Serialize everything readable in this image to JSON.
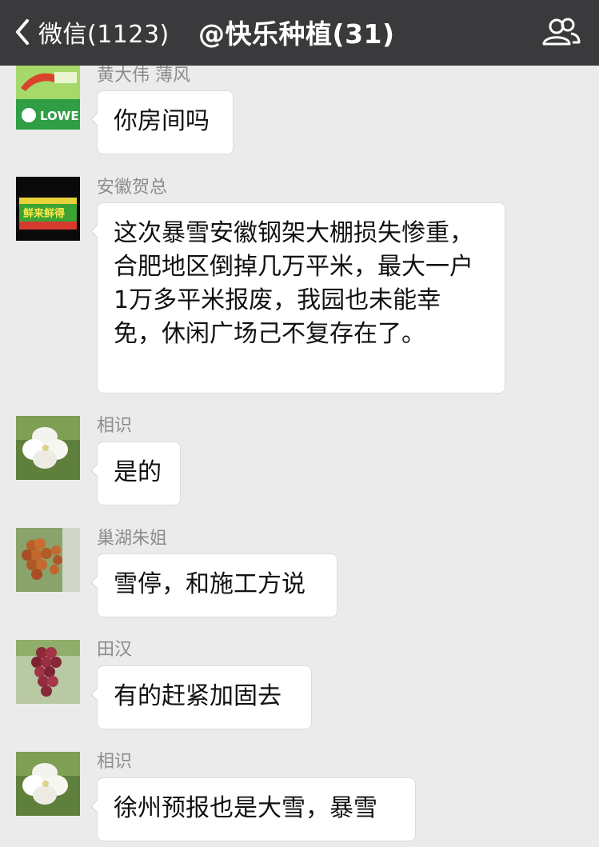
{
  "header": {
    "back_label": "微信(1123)",
    "title": "@快乐种植(31)",
    "bg_color": "#3a3a3c"
  },
  "messages": [
    {
      "sender": "黄大伟 薄风",
      "text": "你房间吗",
      "avatar": "logo-icon"
    },
    {
      "sender": "安徽贺总",
      "text": "这次暴雪安徽钢架大棚损失惨重，合肥地区倒掉几万平米，最大一户1万多平米报废，我园也未能幸免，休闲广场己不复存在了。",
      "avatar": "sign-icon"
    },
    {
      "sender": "相识",
      "text": "是的",
      "avatar": "flower-icon"
    },
    {
      "sender": "巢湖朱姐",
      "text": "雪停，和施工方说",
      "avatar": "grapes-icon"
    },
    {
      "sender": "田汉",
      "text": "有的赶紧加固去",
      "avatar": "grapes-icon"
    },
    {
      "sender": "相识",
      "text": "徐州预报也是大雪，暴雪",
      "avatar": "flower-icon"
    }
  ],
  "avatar_texts": {
    "logo": "LOWE",
    "sign": "鲜来鲜得"
  }
}
